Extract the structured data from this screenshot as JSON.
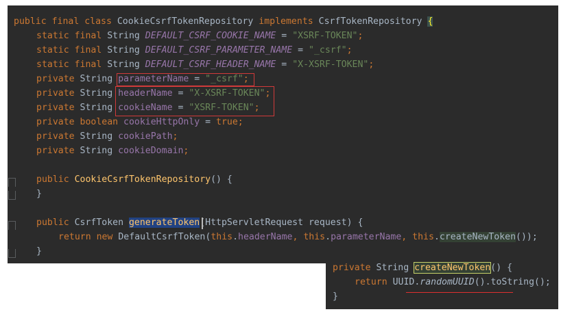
{
  "editor": {
    "lines": [
      [
        "public final class ",
        "CookieCsrfTokenRepository",
        " implements ",
        "CsrfTokenRepository",
        " ",
        "{"
      ],
      [
        "static final ",
        "String ",
        "DEFAULT_CSRF_COOKIE_NAME",
        " = ",
        "\"XSRF-TOKEN\"",
        ";"
      ],
      [
        "static final ",
        "String ",
        "DEFAULT_CSRF_PARAMETER_NAME",
        " = ",
        "\"_csrf\"",
        ";"
      ],
      [
        "static final ",
        "String ",
        "DEFAULT_CSRF_HEADER_NAME",
        " = ",
        "\"X-XSRF-TOKEN\"",
        ";"
      ],
      [
        "private ",
        "String ",
        "parameterName",
        " = ",
        "\"_csrf\"",
        ";"
      ],
      [
        "private ",
        "String ",
        "headerName",
        " = ",
        "\"X-XSRF-TOKEN\"",
        ";"
      ],
      [
        "private ",
        "String ",
        "cookieName",
        " = ",
        "\"XSRF-TOKEN\"",
        ";"
      ],
      [
        "private boolean ",
        "cookieHttpOnly",
        " = ",
        "true",
        ";"
      ],
      [
        "private ",
        "String ",
        "cookiePath",
        ";"
      ],
      [
        "private ",
        "String ",
        "cookieDomain",
        ";"
      ],
      [
        "public ",
        "CookieCsrfTokenRepository",
        "() {"
      ],
      [
        "}"
      ],
      [
        "public ",
        "CsrfToken ",
        "generateToken",
        "(HttpServletRequest request) {"
      ],
      [
        "return new ",
        "DefaultCsrfToken(",
        "this",
        ".",
        "headerName",
        ", ",
        "this",
        ".",
        "parameterName",
        ", ",
        "this",
        ".",
        "createNewToken",
        "());"
      ],
      [
        "}"
      ]
    ]
  },
  "popup": {
    "lines": [
      [
        "private ",
        "String ",
        "createNewToken",
        "() {"
      ],
      [
        "return ",
        "UUID.",
        "randomUUID",
        "().toString();"
      ],
      [
        "}"
      ]
    ]
  }
}
